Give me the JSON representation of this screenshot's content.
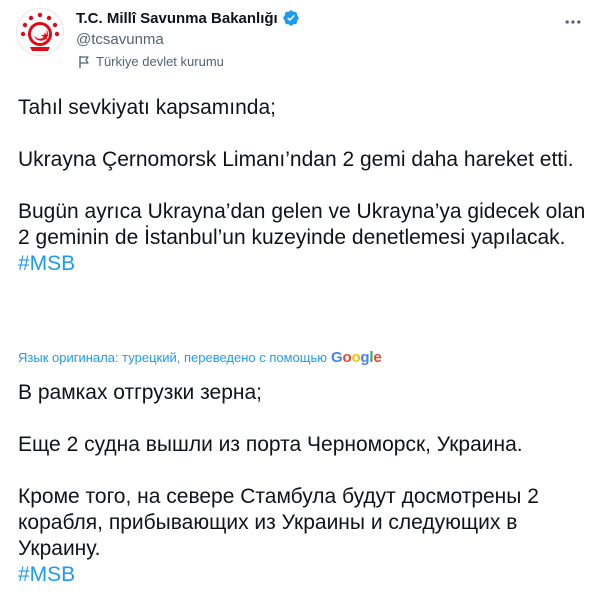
{
  "author": {
    "display_name": "T.C. Millî Savunma Bakanlığı",
    "handle": "@tcsavunma",
    "label": "Türkiye devlet kurumu",
    "avatar_icon": "ministry-emblem-icon",
    "verified_icon": "verified-badge-icon"
  },
  "colors": {
    "link": "#1d9bf0",
    "text": "#0f1419",
    "secondary": "#536471",
    "emblem_red": "#e30a17"
  },
  "tweet": {
    "line1": "Tahıl sevkiyatı kapsamında;",
    "line2": "Ukrayna Çernomorsk Limanı’ndan 2 gemi daha hareket etti.",
    "line3": "Bugün ayrıca Ukrayna’dan gelen ve Ukrayna’ya gidecek olan 2 geminin de İstanbul’un kuzeyinde denetlemesi yapılacak.",
    "hashtag": "#MSB"
  },
  "translation": {
    "note": "Язык оригинала: турецкий, переведено с помощью",
    "provider": {
      "g1": "G",
      "o1": "o",
      "o2": "o",
      "g2": "g",
      "l": "l",
      "e": "e"
    },
    "line1": "В рамках отгрузки зерна;",
    "line2": "Еще 2 судна вышли из порта Черноморск, Украина.",
    "line3": "Кроме того, на севере Стамбула будут досмотрены 2 корабля, прибывающих из Украины и следующих в Украину.",
    "hashtag": "#MSB"
  }
}
